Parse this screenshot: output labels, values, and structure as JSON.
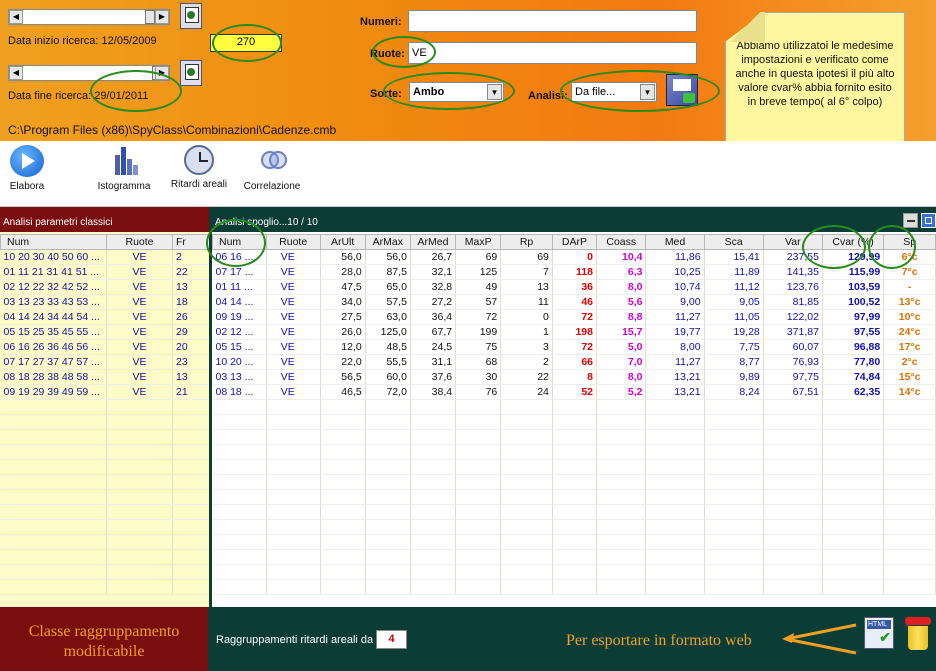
{
  "top": {
    "date_start_label": "Data inizio ricerca: 12/05/2009",
    "date_end_label": "Data fine ricerca: 29/01/2011",
    "value_box": "270",
    "numeri_label": "Numeri:",
    "numeri_value": "",
    "ruote_label": "Ruote:",
    "ruote_value": "VE",
    "sorte_label": "Sorte:",
    "sorte_value": "Ambo",
    "analisi_label": "Analisi:",
    "analisi_value": "Da file...",
    "path": "C:\\Program Files (x86)\\SpyClass\\Combinazioni\\Cadenze.cmb",
    "note": "Abbiamo utilizzatoi le medesime impostazioni e verificato come anche in questa ipotesi il più alto valore cvar% abbia fornito esito in breve tempo( al 6° colpo)"
  },
  "toolbar": {
    "elabora": "Elabora",
    "istogramma": "Istogramma",
    "ritardi": "Ritardi areali",
    "correlazione": "Correlazione"
  },
  "left_panel": {
    "title": "Analisi parametri classici",
    "headers": [
      "Num",
      "Ruote",
      "Fr"
    ],
    "rows": [
      [
        "10 20 30 40 50 60 ...",
        "VE",
        "2"
      ],
      [
        "01 11 21 31 41 51 ...",
        "VE",
        "22"
      ],
      [
        "02 12 22 32 42 52 ...",
        "VE",
        "13"
      ],
      [
        "03 13 23 33 43 53 ...",
        "VE",
        "18"
      ],
      [
        "04 14 24 34 44 54 ...",
        "VE",
        "26"
      ],
      [
        "05 15 25 35 45 55 ...",
        "VE",
        "29"
      ],
      [
        "06 16 26 36 46 56 ...",
        "VE",
        "20"
      ],
      [
        "07 17 27 37 47 57 ...",
        "VE",
        "23"
      ],
      [
        "08 18 28 38 48 58 ...",
        "VE",
        "13"
      ],
      [
        "09 19 29 39 49 59 ...",
        "VE",
        "21"
      ]
    ]
  },
  "right_panel": {
    "title": "Analisi spoglio...10 / 10",
    "headers": [
      "Num",
      "Ruote",
      "ArUlt",
      "ArMax",
      "ArMed",
      "MaxP",
      "Rp",
      "DArP",
      "Coass",
      "Med",
      "Sca",
      "Var",
      "Cvar (%)",
      "Sp"
    ],
    "rows": [
      [
        "06 16 ...",
        "VE",
        "56,0",
        "56,0",
        "26,7",
        "69",
        "69",
        "0",
        "10,4",
        "11,86",
        "15,41",
        "237,55",
        "129,99",
        "6°c"
      ],
      [
        "07 17 ...",
        "VE",
        "28,0",
        "87,5",
        "32,1",
        "125",
        "7",
        "118",
        "6,3",
        "10,25",
        "11,89",
        "141,35",
        "115,99",
        "7°c"
      ],
      [
        "01 11 ...",
        "VE",
        "47,5",
        "65,0",
        "32,8",
        "49",
        "13",
        "36",
        "8,0",
        "10,74",
        "11,12",
        "123,76",
        "103,59",
        "-"
      ],
      [
        "04 14 ...",
        "VE",
        "34,0",
        "57,5",
        "27,2",
        "57",
        "11",
        "46",
        "5,6",
        "9,00",
        "9,05",
        "81,85",
        "100,52",
        "13°c"
      ],
      [
        "09 19 ...",
        "VE",
        "27,5",
        "63,0",
        "36,4",
        "72",
        "0",
        "72",
        "8,8",
        "11,27",
        "11,05",
        "122,02",
        "97,99",
        "10°c"
      ],
      [
        "02 12 ...",
        "VE",
        "26,0",
        "125,0",
        "67,7",
        "199",
        "1",
        "198",
        "15,7",
        "19,77",
        "19,28",
        "371,87",
        "97,55",
        "24°c"
      ],
      [
        "05 15 ...",
        "VE",
        "12,0",
        "48,5",
        "24,5",
        "75",
        "3",
        "72",
        "5,0",
        "8,00",
        "7,75",
        "60,07",
        "96,88",
        "17°c"
      ],
      [
        "10 20 ...",
        "VE",
        "22,0",
        "55,5",
        "31,1",
        "68",
        "2",
        "66",
        "7,0",
        "11,27",
        "8,77",
        "76,93",
        "77,80",
        "2°c"
      ],
      [
        "03 13 ...",
        "VE",
        "56,5",
        "60,0",
        "37,6",
        "30",
        "22",
        "8",
        "8,0",
        "13,21",
        "9,89",
        "97,75",
        "74,84",
        "15°c"
      ],
      [
        "08 18 ...",
        "VE",
        "46,5",
        "72,0",
        "38,4",
        "76",
        "24",
        "52",
        "5,2",
        "13,21",
        "8,24",
        "67,51",
        "62,35",
        "14°c"
      ]
    ]
  },
  "bottom": {
    "classe": "Classe raggruppamento modificabile",
    "raggr_label": "Raggruppamenti ritardi areali da",
    "raggr_value": "4",
    "export": "Per esportare in formato web",
    "html_icon_text": "HTML"
  },
  "colors": {
    "accent": "#f08a10",
    "left_header": "#7a0e0e",
    "right_header": "#0b3d36",
    "highlight": "#2a8a1a"
  }
}
